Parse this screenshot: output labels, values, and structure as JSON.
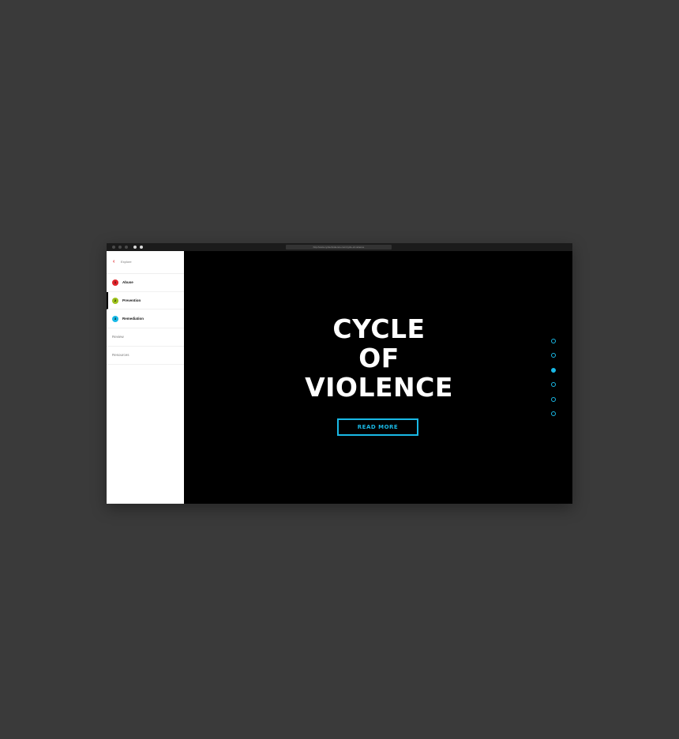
{
  "browser": {
    "url": "http://www.cycleofviolence.com/cycle-of-violence"
  },
  "sidebar": {
    "back_label": "Explore",
    "items": [
      {
        "label": "Abuse",
        "number": "1",
        "color": "#e0252b"
      },
      {
        "label": "Prevention",
        "number": "2",
        "color": "#9ec21d"
      },
      {
        "label": "Remediation",
        "number": "3",
        "color": "#19b9e6"
      }
    ],
    "plain_items": [
      {
        "label": "Review"
      },
      {
        "label": "Resources"
      }
    ]
  },
  "hero": {
    "title_line1": "CYCLE",
    "title_line2": "OF",
    "title_line3": "VIOLENCE",
    "cta_label": "READ MORE"
  },
  "pager": {
    "total": 6,
    "active_index": 2
  },
  "colors": {
    "accent": "#19b9e6",
    "background": "#000000",
    "page_background": "#3a3a3a"
  }
}
